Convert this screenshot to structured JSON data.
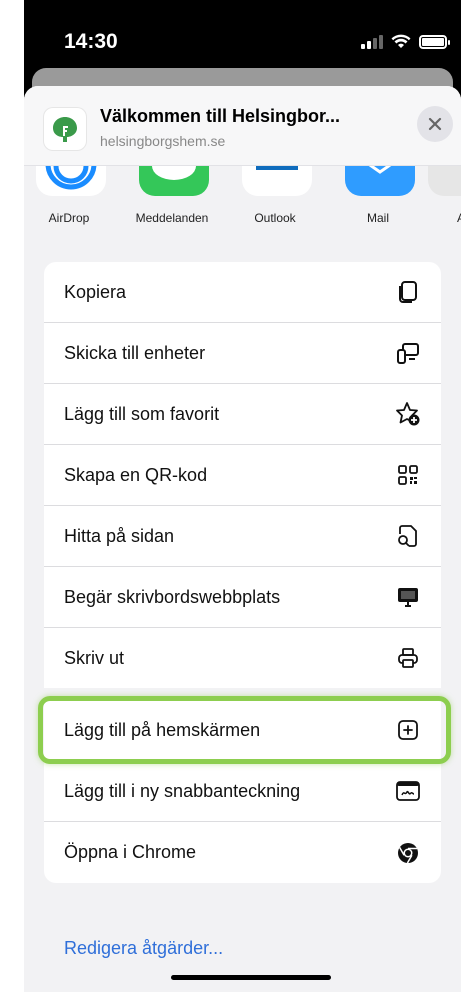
{
  "status_bar": {
    "time": "14:30"
  },
  "header": {
    "title": "Välkommen till Helsingbor...",
    "url": "helsingborgshem.se"
  },
  "share_apps": [
    {
      "label": "AirDrop",
      "icon": "airdrop-icon",
      "color": "#1a8cff"
    },
    {
      "label": "Meddelanden",
      "icon": "messages-icon",
      "color": "#34c759"
    },
    {
      "label": "Outlook",
      "icon": "outlook-icon",
      "color": "#0f6cbd"
    },
    {
      "label": "Mail",
      "icon": "mail-icon",
      "color": "#2f9cff"
    },
    {
      "label": "A",
      "icon": "app-icon",
      "color": "#dddddd"
    }
  ],
  "actions": [
    {
      "label": "Kopiera",
      "icon": "copy-icon"
    },
    {
      "label": "Skicka till enheter",
      "icon": "send-to-devices-icon"
    },
    {
      "label": "Lägg till som favorit",
      "icon": "add-favorite-icon"
    },
    {
      "label": "Skapa en QR-kod",
      "icon": "qr-code-icon"
    },
    {
      "label": "Hitta på sidan",
      "icon": "find-in-page-icon"
    },
    {
      "label": "Begär skrivbordswebbplats",
      "icon": "desktop-site-icon"
    },
    {
      "label": "Skriv ut",
      "icon": "print-icon"
    },
    {
      "label": "Lägg till på hemskärmen",
      "icon": "add-to-home-icon",
      "highlighted": true
    },
    {
      "label": "Lägg till i ny snabbanteckning",
      "icon": "quick-note-icon"
    },
    {
      "label": "Öppna i Chrome",
      "icon": "chrome-icon"
    }
  ],
  "edit_actions": "Redigera åtgärder...",
  "colors": {
    "highlight": "#8dce4f",
    "link": "#2f6fd9",
    "brand": "#3a9a4a"
  }
}
